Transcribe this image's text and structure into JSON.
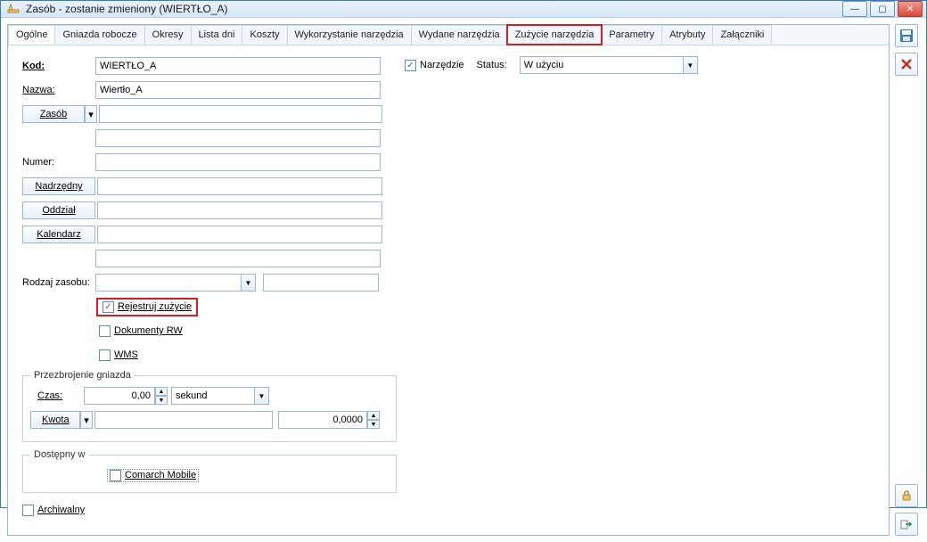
{
  "window": {
    "title": "Zasób - zostanie zmieniony  (WIERTŁO_A)"
  },
  "tabs": [
    {
      "label": "Ogólne",
      "selected": true,
      "highlight": false
    },
    {
      "label": "Gniazda robocze",
      "selected": false,
      "highlight": false
    },
    {
      "label": "Okresy",
      "selected": false,
      "highlight": false
    },
    {
      "label": "Lista dni",
      "selected": false,
      "highlight": false
    },
    {
      "label": "Koszty",
      "selected": false,
      "highlight": false
    },
    {
      "label": "Wykorzystanie narzędzia",
      "selected": false,
      "highlight": false
    },
    {
      "label": "Wydane narzędzia",
      "selected": false,
      "highlight": false
    },
    {
      "label": "Zużycie narzędzia",
      "selected": false,
      "highlight": true
    },
    {
      "label": "Parametry",
      "selected": false,
      "highlight": false
    },
    {
      "label": "Atrybuty",
      "selected": false,
      "highlight": false
    },
    {
      "label": "Załączniki",
      "selected": false,
      "highlight": false
    }
  ],
  "labels": {
    "kod": "Kod:",
    "nazwa": "Nazwa:",
    "zasob_btn": "Zasób",
    "numer": "Numer:",
    "nadrzedny_btn": "Nadrzędny",
    "oddzial_btn": "Oddział",
    "kalendarz_btn": "Kalendarz",
    "rodzaj_zasobu": "Rodzaj zasobu:",
    "rejestruj": "Rejestruj zużycie",
    "dok_rw": "Dokumenty RW",
    "wms": "WMS",
    "przez_gniazda": "Przezbrojenie gniazda",
    "czas": "Czas:",
    "sekund": "sekund",
    "kwota_btn": "Kwota",
    "dostepny": "Dostępny w",
    "comarch": "Comarch Mobile",
    "archiwalny": "Archiwalny",
    "narzedzie": "Narzędzie",
    "status": "Status:"
  },
  "values": {
    "kod": "WIERTŁO_A",
    "nazwa": "Wiertło_A",
    "zasob": "",
    "zasob_extra": "",
    "numer": "",
    "nadrzedny": "",
    "oddzial": "",
    "kalendarz": "",
    "kalendarz_extra": "",
    "rodzaj_zasobu": "",
    "rodzaj_zasobu_extra": "",
    "czas": "0,00",
    "kwota": "",
    "kwota_num": "0,0000",
    "status_selected": "W użyciu"
  },
  "checks": {
    "narzedzie": true,
    "rejestruj": true,
    "dok_rw": false,
    "wms": false,
    "comarch": false,
    "archiwalny": false
  },
  "icons": {
    "save": "save-icon",
    "cancel": "cancel-icon",
    "lock": "lock-icon",
    "out": "export-icon"
  }
}
